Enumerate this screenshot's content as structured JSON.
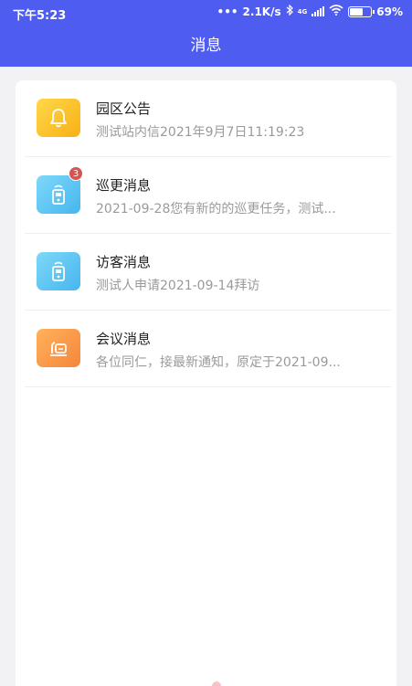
{
  "status_bar": {
    "time": "下午5:23",
    "net_speed": "2.1K/s",
    "network_type": "4G",
    "battery_label": "69%",
    "battery_level": 0.69
  },
  "header": {
    "title": "消息"
  },
  "messages": [
    {
      "title": "园区公告",
      "subtitle": "测试站内信2021年9月7日11:19:23",
      "icon": "bell-icon",
      "badge": ""
    },
    {
      "title": "巡更消息",
      "subtitle": "2021-09-28您有新的的巡更任务，测试...",
      "icon": "patrol-device-icon",
      "badge": "3"
    },
    {
      "title": "访客消息",
      "subtitle": "测试人申请2021-09-14拜访",
      "icon": "visitor-device-icon",
      "badge": ""
    },
    {
      "title": "会议消息",
      "subtitle": "各位同仁，接最新通知，原定于2021-09...",
      "icon": "meeting-icon",
      "badge": ""
    }
  ],
  "colors": {
    "brand": "#4f5cf0",
    "badge": "#d9534f"
  }
}
